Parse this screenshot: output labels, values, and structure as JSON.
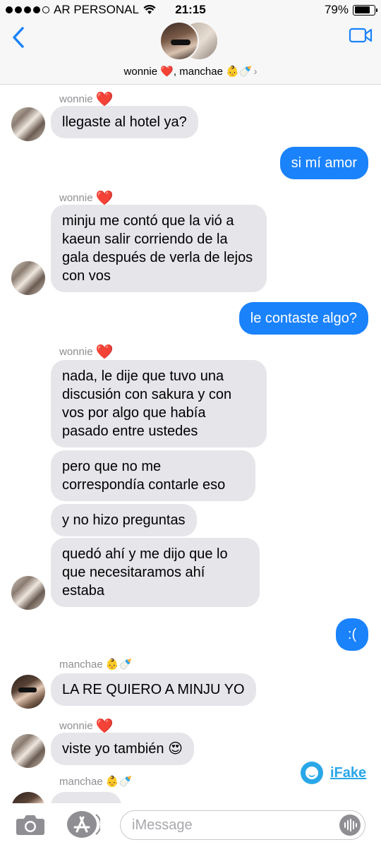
{
  "status_bar": {
    "carrier": "AR PERSONAL",
    "time": "21:15",
    "battery": "79%",
    "battery_level": 0.79,
    "signal_bars_filled": 4,
    "signal_bars_total": 5
  },
  "header": {
    "group_name": "wonnie ❤️, manchae 👶🍼",
    "back_icon": "chevron-left-icon",
    "video_icon": "video-camera-icon"
  },
  "messages": [
    {
      "from": "wonnie",
      "sender_label": "wonnie",
      "text": "llegaste al hotel ya?"
    },
    {
      "from": "me",
      "text": "si mí amor"
    },
    {
      "from": "wonnie",
      "sender_label": "wonnie",
      "text": "minju me contó que la vió a kaeun salir corriendo de la gala después de verla de lejos con vos"
    },
    {
      "from": "me",
      "text": "le contaste algo?"
    },
    {
      "from": "wonnie",
      "sender_label": "wonnie",
      "text": "nada, le dije que tuvo una discusión con sakura y con vos por algo que había pasado entre ustedes"
    },
    {
      "from": "wonnie",
      "text": "pero que no me correspondía contarle eso"
    },
    {
      "from": "wonnie",
      "text": "y no hizo preguntas"
    },
    {
      "from": "wonnie",
      "text": "quedó ahí y me dijo que lo que necesitaramos ahí estaba"
    },
    {
      "from": "me",
      "text": ":("
    },
    {
      "from": "manchae",
      "sender_label": "manchae",
      "text": "LA RE QUIERO A MINJU YO"
    },
    {
      "from": "wonnie",
      "sender_label": "wonnie",
      "text": "viste yo también 😍"
    },
    {
      "from": "manchae",
      "sender_label": "manchae",
      "text": ""
    }
  ],
  "sender_emojis": {
    "wonnie": "❤️",
    "manchae": "👶🍼"
  },
  "watermark": {
    "label": "iFake",
    "icon": "smiley-icon"
  },
  "composer": {
    "placeholder": "iMessage",
    "camera_icon": "camera-icon",
    "apps_icon": "app-store-icon",
    "audio_icon": "waveform-icon"
  },
  "colors": {
    "outgoing": "#1a82fb",
    "incoming": "#e5e5ea",
    "accent": "#1a82fb",
    "watermark": "#29a7e8"
  }
}
